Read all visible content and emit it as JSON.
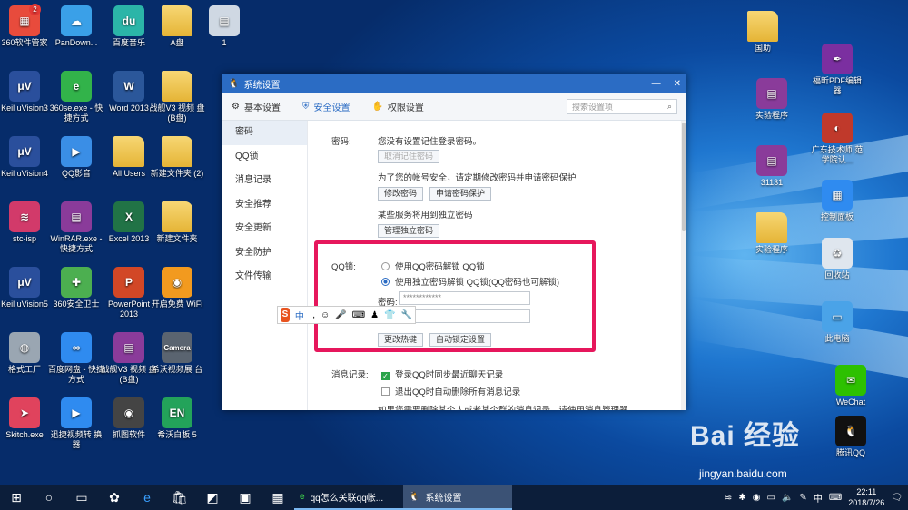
{
  "desktop_icons_left": [
    {
      "label": "360软件管家",
      "color": "#e84b3c",
      "glyph": "▦",
      "badge": "2"
    },
    {
      "label": "PanDown...",
      "color": "#3aa0e8",
      "glyph": "☁"
    },
    {
      "label": "百度音乐",
      "color": "#2bb5a8",
      "glyph": "du"
    },
    {
      "label": "A盘",
      "color": "folder",
      "glyph": ""
    },
    {
      "label": "1",
      "color": "#cfd8e3",
      "glyph": "▤"
    },
    {
      "label": "Keil uVision3",
      "color": "#2a4f9c",
      "glyph": "μV"
    },
    {
      "label": "360se.exe - 快捷方式",
      "color": "#32b34a",
      "glyph": "e"
    },
    {
      "label": "Word 2013",
      "color": "#2b579a",
      "glyph": "W"
    },
    {
      "label": "战舰V3 视频 盘(B盘)",
      "color": "folder",
      "glyph": ""
    },
    {
      "label": "Keil uVision4",
      "color": "#2a4f9c",
      "glyph": "μV"
    },
    {
      "label": "QQ影音",
      "color": "#3a8ee6",
      "glyph": "▶"
    },
    {
      "label": "All Users",
      "color": "folder",
      "glyph": ""
    },
    {
      "label": "新建文件夹 (2)",
      "color": "folder",
      "glyph": ""
    },
    {
      "label": "stc-isp",
      "color": "#d23a6a",
      "glyph": "≋"
    },
    {
      "label": "WinRAR.exe - 快捷方式",
      "color": "#8a3b9a",
      "glyph": "▤"
    },
    {
      "label": "Excel 2013",
      "color": "#217346",
      "glyph": "X"
    },
    {
      "label": "新建文件夹",
      "color": "folder",
      "glyph": ""
    },
    {
      "label": "Keil uVision5",
      "color": "#2a4f9c",
      "glyph": "μV"
    },
    {
      "label": "360安全卫士",
      "color": "#4caf50",
      "glyph": "✚"
    },
    {
      "label": "PowerPoint 2013",
      "color": "#d24726",
      "glyph": "P"
    },
    {
      "label": "开启免费 WiFi",
      "color": "#f29a1f",
      "glyph": "◉"
    },
    {
      "label": "格式工厂",
      "color": "#9aa6b2",
      "glyph": "◍"
    },
    {
      "label": "百度网盘 - 快捷方式",
      "color": "#2f8bf0",
      "glyph": "∞"
    },
    {
      "label": "战舰V3 视频 盘(B盘)",
      "color": "#8a3b9a",
      "glyph": "▤"
    },
    {
      "label": "希沃视频展 台",
      "color": "#5a6470",
      "glyph": "Camera"
    },
    {
      "label": "Skitch.exe",
      "color": "#e0435d",
      "glyph": "➤"
    },
    {
      "label": "迅捷视频转 换器",
      "color": "#2f8bf0",
      "glyph": "▶"
    },
    {
      "label": "抓图软件",
      "color": "#444",
      "glyph": "◉"
    },
    {
      "label": "希沃白板 5",
      "color": "#23a35a",
      "glyph": "EN"
    }
  ],
  "desktop_icons_right": [
    {
      "label": "国助",
      "color": "folder",
      "glyph": ""
    },
    {
      "label": "福昕PDF编辑 器",
      "color": "#7b2fa0",
      "glyph": "✒"
    },
    {
      "label": "实验程序",
      "color": "#8a3b9a",
      "glyph": "▤"
    },
    {
      "label": "广东技术师 范学院认...",
      "color": "#c0392b",
      "glyph": "◐"
    },
    {
      "label": "31131",
      "color": "#8a3b9a",
      "glyph": "▤"
    },
    {
      "label": "控制面板",
      "color": "#2f8bf0",
      "glyph": "▦"
    },
    {
      "label": "实验程序",
      "color": "folder",
      "glyph": ""
    },
    {
      "label": "回收站",
      "color": "#dfe6ee",
      "glyph": "♻"
    },
    {
      "label": "此电脑",
      "color": "#4aa3e8",
      "glyph": "▭"
    },
    {
      "label": "WeChat",
      "color": "#2dc100",
      "glyph": "✉"
    },
    {
      "label": "腾讯QQ",
      "color": "#111",
      "glyph": "🐧"
    }
  ],
  "window": {
    "title": "系统设置",
    "tabs": [
      {
        "label": "基本设置",
        "icon": "⚙"
      },
      {
        "label": "安全设置",
        "icon": "⛨"
      },
      {
        "label": "权限设置",
        "icon": "✋"
      }
    ],
    "search_placeholder": "搜索设置项",
    "sidebar": [
      "密码",
      "QQ锁",
      "消息记录",
      "安全推荐",
      "安全更新",
      "安全防护",
      "文件传输"
    ],
    "password": {
      "label": "密码:",
      "status": "您没有设置记住登录密码。",
      "clear_btn": "取消记住密码",
      "tip": "为了您的帐号安全，请定期修改密码并申请密码保护",
      "change_btn": "修改密码",
      "protect_btn": "申请密码保护",
      "independent_tip": "某些服务将用到独立密码",
      "manage_btn": "管理独立密码"
    },
    "qqlock": {
      "label": "QQ锁:",
      "option1": "使用QQ密码解锁 QQ锁",
      "option2": "使用独立密码解锁 QQ锁(QQ密码也可解锁)",
      "pwd_label": "密码:",
      "pwd_value": "************",
      "hotkey_btn": "更改热键",
      "autolock_btn": "自动锁定设置"
    },
    "msg": {
      "label": "消息记录:",
      "opt1": "登录QQ时同步最近聊天记录",
      "opt2": "退出QQ时自动删除所有消息记录",
      "opt3": "如果您需要删除某个人或者某个群的消息记录，请使用消息管理器"
    }
  },
  "ime": {
    "logo": "S",
    "lang": "中"
  },
  "taskbar": {
    "apps": [
      {
        "label": "qq怎么关联qq帐...",
        "icon": "e"
      },
      {
        "label": "系统设置",
        "icon": "🐧"
      }
    ],
    "ime": "中",
    "time": "22:11",
    "date": "2018/7/26"
  },
  "watermark": {
    "brand": "Bai 经验",
    "url": "jingyan.baidu.com"
  }
}
